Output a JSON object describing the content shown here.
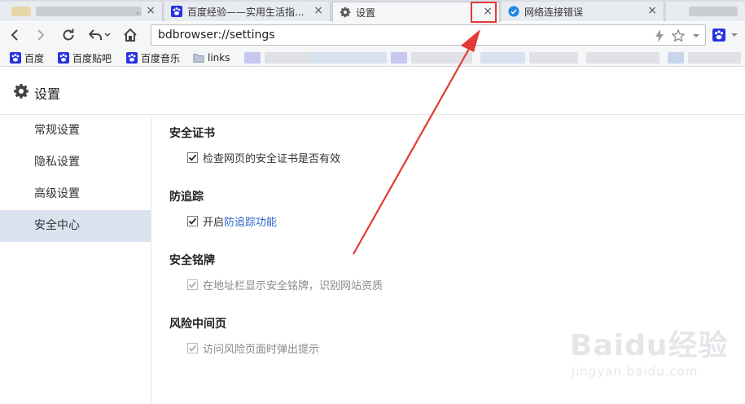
{
  "tabs": [
    {
      "title": "",
      "blurred": true
    },
    {
      "title": "百度经验——实用生活指...",
      "favicon": "baidu-paw-icon"
    },
    {
      "title": "设置",
      "favicon": "gear-icon",
      "active": true
    },
    {
      "title": "网络连接错误",
      "favicon": "globe-icon"
    }
  ],
  "tab_close_glyph": "×",
  "address_bar": {
    "url": "bdbrowser://settings"
  },
  "bookmarks": [
    {
      "label": "百度",
      "icon": "baidu-paw-icon"
    },
    {
      "label": "百度贴吧",
      "icon": "baidu-paw-icon"
    },
    {
      "label": "百度音乐",
      "icon": "baidu-paw-icon"
    },
    {
      "label": "links",
      "icon": "folder-icon"
    }
  ],
  "page": {
    "title": "设置"
  },
  "sidebar": {
    "items": [
      {
        "label": "常规设置"
      },
      {
        "label": "隐私设置"
      },
      {
        "label": "高级设置"
      },
      {
        "label": "安全中心",
        "active": true
      }
    ]
  },
  "sections": [
    {
      "title": "安全证书",
      "option": "检查网页的安全证书是否有效",
      "checked": true,
      "disabled": false
    },
    {
      "title": "防追踪",
      "option_prefix": "开启",
      "option_link": "防追踪功能",
      "checked": true,
      "disabled": false
    },
    {
      "title": "安全铭牌",
      "option": "在地址栏显示安全铭牌，识别网站资质",
      "checked": true,
      "disabled": true
    },
    {
      "title": "风险中间页",
      "option": "访问风险页面时弹出提示",
      "checked": true,
      "disabled": true
    }
  ],
  "watermark": {
    "brand": "Baidu经验",
    "site": "jingyan.baidu.com"
  },
  "colors": {
    "accent_link": "#2a66c9",
    "sidebar_active": "#dbe3f1",
    "annotation": "#e53935",
    "baidu_blue": "#2932e1"
  }
}
